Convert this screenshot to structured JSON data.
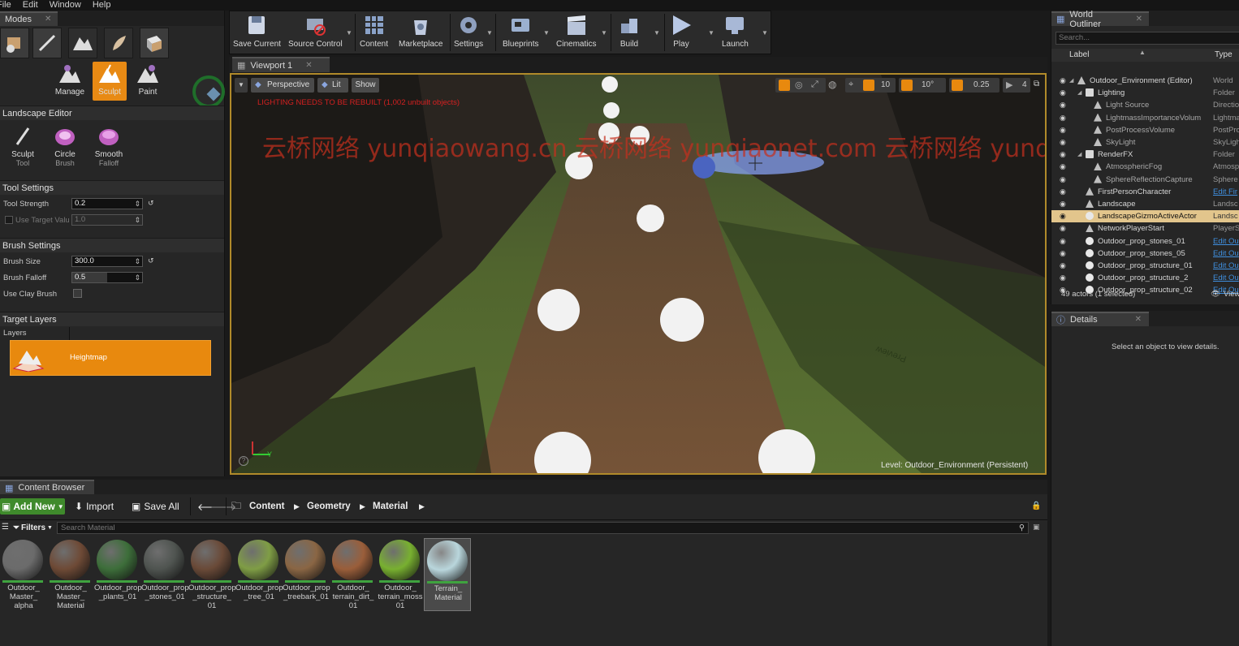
{
  "menu": [
    "File",
    "Edit",
    "Window",
    "Help"
  ],
  "modes": {
    "tab_label": "Modes",
    "tools": [
      "Manage",
      "Sculpt",
      "Paint"
    ],
    "editor_title": "Landscape Editor",
    "brush_tools": [
      {
        "label1": "Sculpt",
        "label2": "Tool"
      },
      {
        "label1": "Circle",
        "label2": "Brush"
      },
      {
        "label1": "Smooth",
        "label2": "Falloff"
      }
    ],
    "tool_settings": {
      "title": "Tool Settings",
      "tool_strength_label": "Tool Strength",
      "tool_strength_value": "0.2",
      "use_target_label": "Use Target Valu",
      "use_target_value": "1.0"
    },
    "brush_settings": {
      "title": "Brush Settings",
      "brush_size_label": "Brush Size",
      "brush_size_value": "300.0",
      "brush_falloff_label": "Brush Falloff",
      "brush_falloff_value": "0.5",
      "clay_label": "Use Clay Brush"
    },
    "target_layers": {
      "title": "Target Layers",
      "layers_label": "Layers",
      "heightmap_label": "Heightmap"
    }
  },
  "toolbar": {
    "buttons": [
      "Save Current",
      "Source Control",
      "Content",
      "Marketplace",
      "Settings",
      "Blueprints",
      "Cinematics",
      "Build",
      "Play",
      "Launch"
    ]
  },
  "viewport": {
    "tab_label": "Viewport 1",
    "perspective": "Perspective",
    "lit": "Lit",
    "show": "Show",
    "warning": "LIGHTING NEEDS TO BE REBUILT (1,002 unbuilt objects)",
    "grid_value": "10",
    "angle_value": "10°",
    "scale_value": "0.25",
    "camera_speed": "4",
    "level_label": "Level:",
    "level_name": "Outdoor_Environment (Persistent)",
    "watermark": "云桥网络 yunqiaowang.cn 云桥网络 yunqiaonet.com 云桥网络 yunqiaowang.cn 云桥网络 yunqiaonet.com",
    "axis_y": "Y",
    "preview_text": "Preview"
  },
  "outliner": {
    "tab_label": "World Outliner",
    "search_placeholder": "Search...",
    "col_label": "Label",
    "col_type": "Type",
    "rows": [
      {
        "label": "Outdoor_Environment (Editor)",
        "type": "World",
        "indent": 0
      },
      {
        "label": "Lighting",
        "type": "Folder",
        "indent": 1
      },
      {
        "label": "Light Source",
        "type": "Directio",
        "indent": 2
      },
      {
        "label": "LightmassImportanceVolum",
        "type": "Lightma",
        "indent": 2
      },
      {
        "label": "PostProcessVolume",
        "type": "PostPro",
        "indent": 2
      },
      {
        "label": "SkyLight",
        "type": "SkyLigh",
        "indent": 2
      },
      {
        "label": "RenderFX",
        "type": "Folder",
        "indent": 1
      },
      {
        "label": "AtmosphericFog",
        "type": "Atmosp",
        "indent": 2
      },
      {
        "label": "SphereReflectionCapture",
        "type": "Sphere",
        "indent": 2
      },
      {
        "label": "FirstPersonCharacter",
        "type": "Edit Fir",
        "indent": 1,
        "link": true
      },
      {
        "label": "Landscape",
        "type": "Landsc",
        "indent": 1
      },
      {
        "label": "LandscapeGizmoActiveActor",
        "type": "Landsc",
        "indent": 1,
        "selected": true
      },
      {
        "label": "NetworkPlayerStart",
        "type": "PlayerS",
        "indent": 1
      },
      {
        "label": "Outdoor_prop_stones_01",
        "type": "Edit Ou",
        "indent": 1,
        "link": true
      },
      {
        "label": "Outdoor_prop_stones_05",
        "type": "Edit Ou",
        "indent": 1,
        "link": true
      },
      {
        "label": "Outdoor_prop_structure_01",
        "type": "Edit Ou",
        "indent": 1,
        "link": true
      },
      {
        "label": "Outdoor_prop_structure_2",
        "type": "Edit Ou",
        "indent": 1,
        "link": true
      },
      {
        "label": "Outdoor_prop_structure_02",
        "type": "Edit Ou",
        "indent": 1,
        "link": true
      }
    ],
    "status": "49 actors (1 selected)",
    "view_label": "View"
  },
  "details": {
    "tab_label": "Details",
    "message": "Select an object to view details."
  },
  "content_browser": {
    "tab_label": "Content Browser",
    "add_new": "Add New",
    "import": "Import",
    "save_all": "Save All",
    "breadcrumb": [
      "Content",
      "Geometry",
      "Material"
    ],
    "filters": "Filters",
    "search_placeholder": "Search Material",
    "assets": [
      {
        "name": "Outdoor_ Master_ alpha",
        "color": "#6b6b6b"
      },
      {
        "name": "Outdoor_ Master_ Material",
        "color": "#6e4a36"
      },
      {
        "name": "Outdoor_prop _plants_01",
        "color": "#3d6e3a"
      },
      {
        "name": "Outdoor_prop _stones_01",
        "color": "#4f5450"
      },
      {
        "name": "Outdoor_prop _structure_ 01",
        "color": "#6a4a38"
      },
      {
        "name": "Outdoor_prop _tree_01",
        "color": "#7f9d45"
      },
      {
        "name": "Outdoor_prop _treebark_01",
        "color": "#8a6644"
      },
      {
        "name": "Outdoor_ terrain_dirt_ 01",
        "color": "#9a5e3a"
      },
      {
        "name": "Outdoor_ terrain_moss 01",
        "color": "#78b030"
      },
      {
        "name": "Terrain_ Material",
        "color": "#b9d6dc"
      }
    ]
  }
}
